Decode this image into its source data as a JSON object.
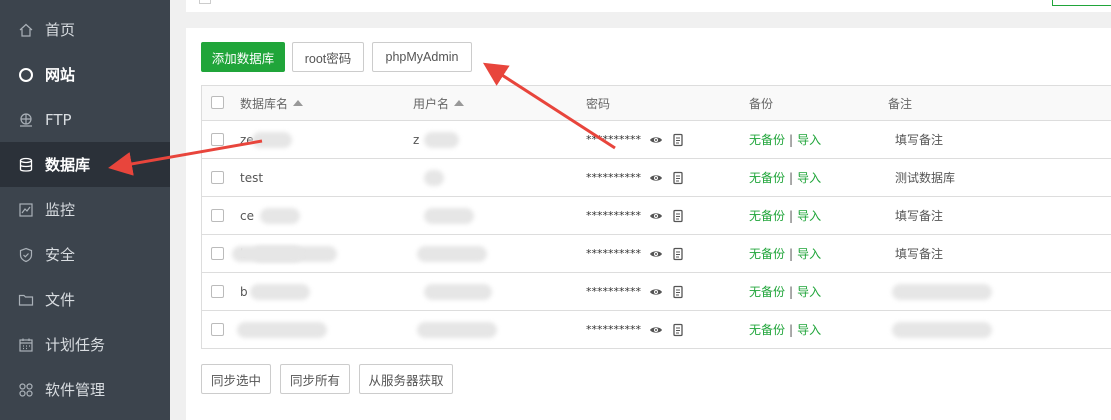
{
  "sidebar": {
    "items": [
      {
        "label": "首页",
        "icon": "home-icon"
      },
      {
        "label": "网站",
        "icon": "globe-icon"
      },
      {
        "label": "FTP",
        "icon": "ftp-icon"
      },
      {
        "label": "数据库",
        "icon": "database-icon"
      },
      {
        "label": "监控",
        "icon": "monitor-icon"
      },
      {
        "label": "安全",
        "icon": "shield-icon"
      },
      {
        "label": "文件",
        "icon": "folder-icon"
      },
      {
        "label": "计划任务",
        "icon": "calendar-icon"
      },
      {
        "label": "软件管理",
        "icon": "apps-icon"
      }
    ],
    "active_index": 3
  },
  "toolbar": {
    "add_db_label": "添加数据库",
    "root_pwd_label": "root密码",
    "phpmyadmin_label": "phpMyAdmin"
  },
  "table": {
    "headers": {
      "name": "数据库名",
      "user": "用户名",
      "password": "密码",
      "backup": "备份",
      "note": "备注"
    },
    "rows": [
      {
        "name": "ze",
        "user": "z",
        "password": "**********",
        "backup_status": "无备份",
        "import": "导入",
        "note": "填写备注"
      },
      {
        "name": "test",
        "user": "",
        "password": "**********",
        "backup_status": "无备份",
        "import": "导入",
        "note": "测试数据库"
      },
      {
        "name": "ce",
        "user": "",
        "password": "**********",
        "backup_status": "无备份",
        "import": "导入",
        "note": "填写备注"
      },
      {
        "name": "b",
        "user": "",
        "password": "**********",
        "backup_status": "无备份",
        "import": "导入",
        "note": "填写备注"
      },
      {
        "name": "b",
        "user": "",
        "password": "**********",
        "backup_status": "无备份",
        "import": "导入",
        "note": ""
      },
      {
        "name": "",
        "user": "",
        "password": "**********",
        "backup_status": "无备份",
        "import": "导入",
        "note": ""
      }
    ],
    "separator": "|"
  },
  "footer": {
    "sync_selected": "同步选中",
    "sync_all": "同步所有",
    "fetch_from_server": "从服务器获取"
  },
  "colors": {
    "sidebar_bg": "#3c444d",
    "sidebar_active": "#2b3139",
    "accent_green": "#20a53a",
    "annotation_red": "#e8453c"
  }
}
